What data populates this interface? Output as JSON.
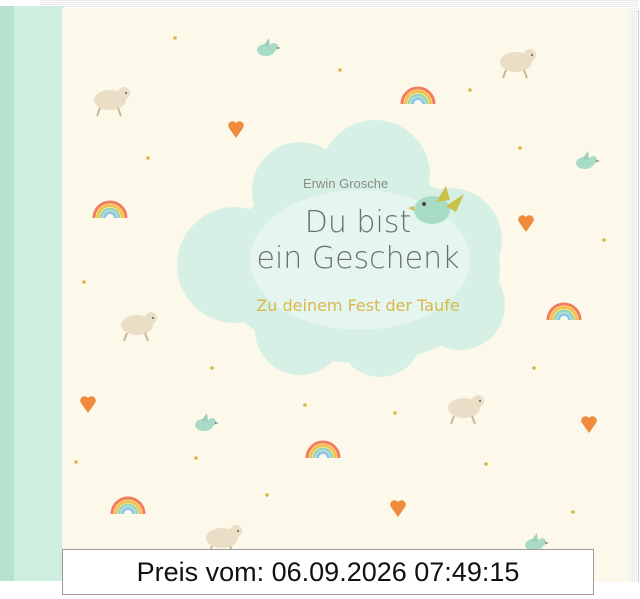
{
  "cover": {
    "author": "Erwin Grosche",
    "title_line1": "Du bist",
    "title_line2": "ein Geschenk",
    "subtitle": "Zu deinem Fest der Taufe"
  },
  "price_banner": {
    "text": "Preis vom: 06.09.2026 07:49:15"
  },
  "colors": {
    "cover_background": "#fdf9ea",
    "spine": "#cfeee0",
    "cloud": "#d7f0e6",
    "subtitle": "#d8b84a",
    "heart": "#f08a3c"
  },
  "decorations": [
    "sheep-icon",
    "bird-icon",
    "rainbow-icon",
    "heart-icon",
    "dot"
  ]
}
